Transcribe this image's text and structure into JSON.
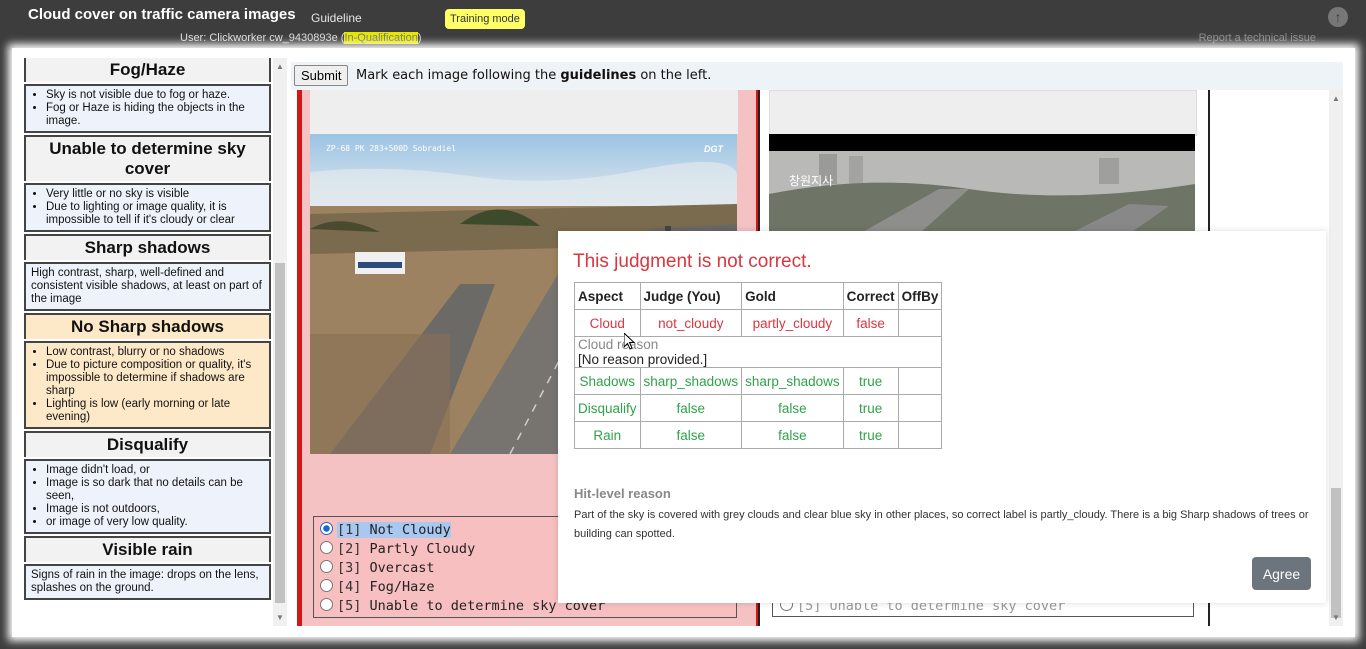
{
  "header": {
    "title": "Cloud cover on traffic camera images",
    "guideline_link": "Guideline",
    "training_badge": "Training mode",
    "user_prefix": "User:  Clickworker cw_9430893e (",
    "user_status": "In-Qualification",
    "user_suffix": ")",
    "report_link": "Report a technical issue"
  },
  "guideline": {
    "sections": [
      {
        "title": "Fog/Haze",
        "items": [
          "Sky is not visible due to fog or haze.",
          "Fog or Haze is hiding the objects in the image."
        ]
      },
      {
        "title": "Unable to determine sky cover",
        "items": [
          "Very little or no sky is visible",
          "Due to lighting or image quality, it is impossible to tell if it's cloudy or clear"
        ]
      },
      {
        "title": "Sharp shadows",
        "text": "High contrast, sharp, well-defined and consistent visible shadows, at least on part of the image"
      },
      {
        "title": "No Sharp shadows",
        "items": [
          "Low contrast, blurry or no shadows",
          "Due to picture composition or quality, it's impossible to determine if shadows are sharp",
          "Lighting is low (early morning or late evening)"
        ]
      },
      {
        "title": "Disqualify",
        "items": [
          "Image didn't load, or",
          "Image is so dark that no details can be seen,",
          "Image is not outdoors,",
          "or image of very low quality."
        ]
      },
      {
        "title": "Visible rain",
        "text": "Signs of rain in the image: drops on the lens, splashes on the ground."
      }
    ]
  },
  "toolbar": {
    "submit_label": "Submit",
    "instruction_prefix": "Mark each image following the ",
    "instruction_bold": "guidelines",
    "instruction_suffix": " on the left."
  },
  "left_card": {
    "camera_overlay": "ZP-68 PK 283+500D Sobradiel",
    "camera_brand": "DGT",
    "options": [
      {
        "num": "[1]",
        "label": "Not Cloudy",
        "selected": true
      },
      {
        "num": "[2]",
        "label": "Partly Cloudy",
        "selected": false
      },
      {
        "num": "[3]",
        "label": "Overcast",
        "selected": false
      },
      {
        "num": "[4]",
        "label": "Fog/Haze",
        "selected": false
      },
      {
        "num": "[5]",
        "label": "Unable to determine sky cover",
        "selected": false
      }
    ]
  },
  "right_card": {
    "camera_overlay": "창원지사",
    "option_partial": "[5] Unable to determine sky cover"
  },
  "modal": {
    "title": "This judgment is not correct.",
    "columns": [
      "Aspect",
      "Judge (You)",
      "Gold",
      "Correct",
      "OffBy"
    ],
    "rows": [
      {
        "aspect": "Cloud",
        "judge": "not_cloudy",
        "gold": "partly_cloudy",
        "correct": "false",
        "offby": "",
        "status": "red"
      },
      {
        "aspect": "Shadows",
        "judge": "sharp_shadows",
        "gold": "sharp_shadows",
        "correct": "true",
        "offby": "",
        "status": "green"
      },
      {
        "aspect": "Disqualify",
        "judge": "false",
        "gold": "false",
        "correct": "true",
        "offby": "",
        "status": "green"
      },
      {
        "aspect": "Rain",
        "judge": "false",
        "gold": "false",
        "correct": "true",
        "offby": "",
        "status": "green"
      }
    ],
    "cloud_reason_label": "Cloud reason",
    "cloud_reason_text": "[No reason provided.]",
    "hit_reason_label": "Hit-level reason",
    "hit_reason_text": "Part of the sky is covered with grey clouds and clear blue sky in other places, so correct label is partly_cloudy. There is a big Sharp shadows of trees or building can spotted.",
    "agree_label": "Agree"
  },
  "colors": {
    "error": "#d9363e",
    "success": "#2fa24a",
    "selected_border": "#d01818"
  }
}
